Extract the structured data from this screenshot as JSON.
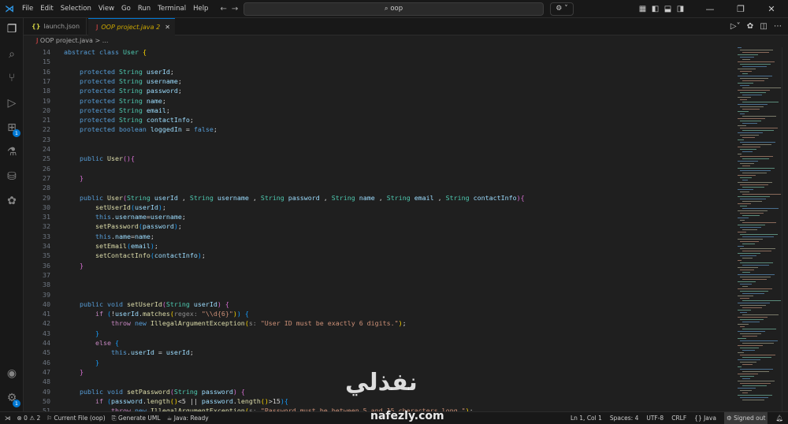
{
  "menu": [
    "File",
    "Edit",
    "Selection",
    "View",
    "Go",
    "Run",
    "Terminal",
    "Help"
  ],
  "search": "oop",
  "tabs": [
    {
      "label": "launch.json",
      "icon": "{}"
    },
    {
      "label": "OOP project.java",
      "problems": "2",
      "icon": "J"
    }
  ],
  "breadcrumb": {
    "file": "OOP project.java",
    "rest": "> ..."
  },
  "activity_badges": {
    "extensions": "1",
    "accounts": "1"
  },
  "code": [
    {
      "n": "14",
      "t": [
        [
          "kw",
          "abstract "
        ],
        [
          "kw",
          "class "
        ],
        [
          "ty",
          "User "
        ],
        [
          "b1",
          "{"
        ]
      ]
    },
    {
      "n": "15",
      "t": []
    },
    {
      "n": "16",
      "t": [
        [
          "pl",
          "    "
        ],
        [
          "kw",
          "protected "
        ],
        [
          "ty",
          "String "
        ],
        [
          "va",
          "userId"
        ],
        [
          "pl",
          ";"
        ]
      ]
    },
    {
      "n": "17",
      "t": [
        [
          "pl",
          "    "
        ],
        [
          "kw",
          "protected "
        ],
        [
          "ty",
          "String "
        ],
        [
          "va",
          "username"
        ],
        [
          "pl",
          ";"
        ]
      ]
    },
    {
      "n": "18",
      "t": [
        [
          "pl",
          "    "
        ],
        [
          "kw",
          "protected "
        ],
        [
          "ty",
          "String "
        ],
        [
          "va",
          "password"
        ],
        [
          "pl",
          ";"
        ]
      ]
    },
    {
      "n": "19",
      "t": [
        [
          "pl",
          "    "
        ],
        [
          "kw",
          "protected "
        ],
        [
          "ty",
          "String "
        ],
        [
          "va",
          "name"
        ],
        [
          "pl",
          ";"
        ]
      ]
    },
    {
      "n": "20",
      "t": [
        [
          "pl",
          "    "
        ],
        [
          "kw",
          "protected "
        ],
        [
          "ty",
          "String "
        ],
        [
          "va",
          "email"
        ],
        [
          "pl",
          ";"
        ]
      ]
    },
    {
      "n": "21",
      "t": [
        [
          "pl",
          "    "
        ],
        [
          "kw",
          "protected "
        ],
        [
          "ty",
          "String "
        ],
        [
          "va",
          "contactInfo"
        ],
        [
          "pl",
          ";"
        ]
      ]
    },
    {
      "n": "22",
      "t": [
        [
          "pl",
          "    "
        ],
        [
          "kw",
          "protected "
        ],
        [
          "kw",
          "boolean "
        ],
        [
          "va",
          "loggedIn"
        ],
        [
          "pl",
          " = "
        ],
        [
          "kw",
          "false"
        ],
        [
          "pl",
          ";"
        ]
      ]
    },
    {
      "n": "23",
      "t": []
    },
    {
      "n": "24",
      "t": []
    },
    {
      "n": "25",
      "t": [
        [
          "pl",
          "    "
        ],
        [
          "kw",
          "public "
        ],
        [
          "fn",
          "User"
        ],
        [
          "b2",
          "()"
        ],
        [
          "b2",
          "{"
        ]
      ]
    },
    {
      "n": "26",
      "t": []
    },
    {
      "n": "27",
      "t": [
        [
          "pl",
          "    "
        ],
        [
          "b2",
          "}"
        ]
      ]
    },
    {
      "n": "28",
      "t": []
    },
    {
      "n": "29",
      "t": [
        [
          "pl",
          "    "
        ],
        [
          "kw",
          "public "
        ],
        [
          "fn",
          "User"
        ],
        [
          "b2",
          "("
        ],
        [
          "ty",
          "String "
        ],
        [
          "va",
          "userId"
        ],
        [
          "pl",
          " , "
        ],
        [
          "ty",
          "String "
        ],
        [
          "va",
          "username"
        ],
        [
          "pl",
          " , "
        ],
        [
          "ty",
          "String "
        ],
        [
          "va",
          "password"
        ],
        [
          "pl",
          " , "
        ],
        [
          "ty",
          "String "
        ],
        [
          "va",
          "name"
        ],
        [
          "pl",
          " , "
        ],
        [
          "ty",
          "String "
        ],
        [
          "va",
          "email"
        ],
        [
          "pl",
          " , "
        ],
        [
          "ty",
          "String "
        ],
        [
          "va",
          "contactInfo"
        ],
        [
          "b2",
          ")"
        ],
        [
          "b2",
          "{"
        ]
      ]
    },
    {
      "n": "30",
      "t": [
        [
          "pl",
          "        "
        ],
        [
          "fn",
          "setUserId"
        ],
        [
          "b3",
          "("
        ],
        [
          "va",
          "userId"
        ],
        [
          "b3",
          ")"
        ],
        [
          "pl",
          ";"
        ]
      ]
    },
    {
      "n": "31",
      "t": [
        [
          "pl",
          "        "
        ],
        [
          "kw",
          "this"
        ],
        [
          "pl",
          "."
        ],
        [
          "va",
          "username"
        ],
        [
          "pl",
          "="
        ],
        [
          "va",
          "username"
        ],
        [
          "pl",
          ";"
        ]
      ]
    },
    {
      "n": "32",
      "t": [
        [
          "pl",
          "        "
        ],
        [
          "fn",
          "setPassword"
        ],
        [
          "b3",
          "("
        ],
        [
          "va",
          "password"
        ],
        [
          "b3",
          ")"
        ],
        [
          "pl",
          ";"
        ]
      ]
    },
    {
      "n": "33",
      "t": [
        [
          "pl",
          "        "
        ],
        [
          "kw",
          "this"
        ],
        [
          "pl",
          "."
        ],
        [
          "va",
          "name"
        ],
        [
          "pl",
          "="
        ],
        [
          "va",
          "name"
        ],
        [
          "pl",
          ";"
        ]
      ]
    },
    {
      "n": "34",
      "t": [
        [
          "pl",
          "        "
        ],
        [
          "fn",
          "setEmail"
        ],
        [
          "b3",
          "("
        ],
        [
          "va",
          "email"
        ],
        [
          "b3",
          ")"
        ],
        [
          "pl",
          ";"
        ]
      ]
    },
    {
      "n": "35",
      "t": [
        [
          "pl",
          "        "
        ],
        [
          "fn",
          "setContactInfo"
        ],
        [
          "b3",
          "("
        ],
        [
          "va",
          "contactInfo"
        ],
        [
          "b3",
          ")"
        ],
        [
          "pl",
          ";"
        ]
      ]
    },
    {
      "n": "36",
      "t": [
        [
          "pl",
          "    "
        ],
        [
          "b2",
          "}"
        ]
      ]
    },
    {
      "n": "37",
      "t": []
    },
    {
      "n": "38",
      "t": []
    },
    {
      "n": "39",
      "t": []
    },
    {
      "n": "40",
      "t": [
        [
          "pl",
          "    "
        ],
        [
          "kw",
          "public "
        ],
        [
          "kw",
          "void "
        ],
        [
          "fn",
          "setUserId"
        ],
        [
          "b2",
          "("
        ],
        [
          "ty",
          "String "
        ],
        [
          "va",
          "userId"
        ],
        [
          "b2",
          ")"
        ],
        [
          "pl",
          " "
        ],
        [
          "b2",
          "{"
        ]
      ]
    },
    {
      "n": "41",
      "t": [
        [
          "pl",
          "        "
        ],
        [
          "ct",
          "if "
        ],
        [
          "b3",
          "("
        ],
        [
          "pl",
          "!"
        ],
        [
          "va",
          "userId"
        ],
        [
          "pl",
          "."
        ],
        [
          "fn",
          "matches"
        ],
        [
          "b1",
          "("
        ],
        [
          "hn",
          "regex: "
        ],
        [
          "st",
          "\"\\\\d{6}\""
        ],
        [
          "b1",
          ")"
        ],
        [
          "b3",
          ")"
        ],
        [
          "pl",
          " "
        ],
        [
          "b3",
          "{"
        ]
      ]
    },
    {
      "n": "42",
      "t": [
        [
          "pl",
          "            "
        ],
        [
          "ct",
          "throw "
        ],
        [
          "kw",
          "new "
        ],
        [
          "fn",
          "IllegalArgumentException"
        ],
        [
          "b1",
          "("
        ],
        [
          "hn",
          "s: "
        ],
        [
          "st",
          "\"User ID must be exactly 6 digits.\""
        ],
        [
          "b1",
          ")"
        ],
        [
          "pl",
          ";"
        ]
      ]
    },
    {
      "n": "43",
      "t": [
        [
          "pl",
          "        "
        ],
        [
          "b3",
          "}"
        ]
      ]
    },
    {
      "n": "44",
      "t": [
        [
          "pl",
          "        "
        ],
        [
          "ct",
          "else "
        ],
        [
          "b3",
          "{"
        ]
      ]
    },
    {
      "n": "45",
      "t": [
        [
          "pl",
          "            "
        ],
        [
          "kw",
          "this"
        ],
        [
          "pl",
          "."
        ],
        [
          "va",
          "userId"
        ],
        [
          "pl",
          " = "
        ],
        [
          "va",
          "userId"
        ],
        [
          "pl",
          ";"
        ]
      ]
    },
    {
      "n": "46",
      "t": [
        [
          "pl",
          "        "
        ],
        [
          "b3",
          "}"
        ]
      ]
    },
    {
      "n": "47",
      "t": [
        [
          "pl",
          "    "
        ],
        [
          "b2",
          "}"
        ]
      ]
    },
    {
      "n": "48",
      "t": []
    },
    {
      "n": "49",
      "t": [
        [
          "pl",
          "    "
        ],
        [
          "kw",
          "public "
        ],
        [
          "kw",
          "void "
        ],
        [
          "fn",
          "setPassword"
        ],
        [
          "b2",
          "("
        ],
        [
          "ty",
          "String "
        ],
        [
          "va",
          "password"
        ],
        [
          "b2",
          ")"
        ],
        [
          "pl",
          " "
        ],
        [
          "b2",
          "{"
        ]
      ]
    },
    {
      "n": "50",
      "t": [
        [
          "pl",
          "        "
        ],
        [
          "ct",
          "if "
        ],
        [
          "b3",
          "("
        ],
        [
          "va",
          "password"
        ],
        [
          "pl",
          "."
        ],
        [
          "fn",
          "length"
        ],
        [
          "b1",
          "()"
        ],
        [
          "pl",
          "<5 || "
        ],
        [
          "va",
          "password"
        ],
        [
          "pl",
          "."
        ],
        [
          "fn",
          "length"
        ],
        [
          "b1",
          "()"
        ],
        [
          "pl",
          ">15"
        ],
        [
          "b3",
          ")"
        ],
        [
          "b3",
          "{"
        ]
      ]
    },
    {
      "n": "51",
      "t": [
        [
          "pl",
          "            "
        ],
        [
          "ct",
          "throw "
        ],
        [
          "kw",
          "new "
        ],
        [
          "fn",
          "IllegalArgumentException"
        ],
        [
          "b1",
          "("
        ],
        [
          "hn",
          "s: "
        ],
        [
          "st",
          "\"Password must be between 5 and 15 characters long.\""
        ],
        [
          "b1",
          ")"
        ],
        [
          "pl",
          ";"
        ]
      ]
    }
  ],
  "status": {
    "errors": "0",
    "warnings": "2",
    "current_file": "Current File (oop)",
    "generate_uml": "Generate UML",
    "java": "Java: Ready",
    "position": "Ln 1, Col 1",
    "spaces": "Spaces: 4",
    "encoding": "UTF-8",
    "eol": "CRLF",
    "language": "{} Java",
    "signed": "Signed out"
  },
  "watermark": {
    "arabic": "نفذلي",
    "url": "nafezly.com"
  }
}
